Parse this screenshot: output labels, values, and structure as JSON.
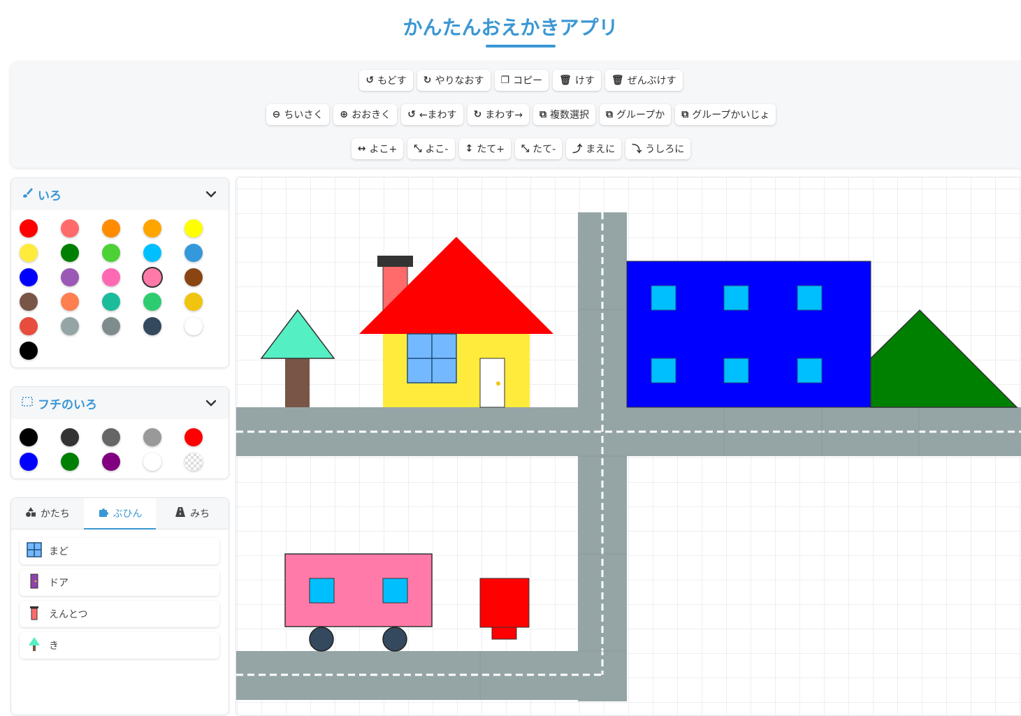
{
  "app": {
    "title": "かんたんおえかきアプリ"
  },
  "toolbar": {
    "row1": [
      {
        "label": "もどす",
        "icon": "undo-icon"
      },
      {
        "label": "やりなおす",
        "icon": "redo-icon"
      },
      {
        "label": "コピー",
        "icon": "copy-icon"
      },
      {
        "label": "けす",
        "icon": "trash-icon"
      },
      {
        "label": "ぜんぶけす",
        "icon": "trash-all-icon"
      }
    ],
    "row2": [
      {
        "label": "ちいさく",
        "icon": "zoom-out-icon"
      },
      {
        "label": "おおきく",
        "icon": "zoom-in-icon"
      },
      {
        "label": "←まわす",
        "icon": "rotate-left-icon"
      },
      {
        "label": "まわす→",
        "icon": "rotate-right-icon"
      },
      {
        "label": "複数選択",
        "icon": "multi-select-icon"
      },
      {
        "label": "グループか",
        "icon": "group-icon"
      },
      {
        "label": "グループかいじょ",
        "icon": "ungroup-icon"
      }
    ],
    "row3": [
      {
        "label": "よこ+",
        "icon": "widen-icon"
      },
      {
        "label": "よこ-",
        "icon": "narrow-icon"
      },
      {
        "label": "たて+",
        "icon": "taller-icon"
      },
      {
        "label": "たて-",
        "icon": "shorter-icon"
      },
      {
        "label": "まえに",
        "icon": "bring-forward-icon"
      },
      {
        "label": "うしろに",
        "icon": "send-backward-icon"
      }
    ]
  },
  "fill_panel": {
    "title": "いろ",
    "icon": "brush-icon",
    "selected": "#ff7aa8",
    "colors": [
      "#ff0000",
      "#ff6b6b",
      "#ff8c00",
      "#ffa500",
      "#ffff00",
      "#ffeb3b",
      "#008000",
      "#4cd137",
      "#00bfff",
      "#3498db",
      "#0000ff",
      "#9b59b6",
      "#ff69b4",
      "#ff7aa8",
      "#8b4513",
      "#795548",
      "#ff7f50",
      "#1abc9c",
      "#2ecc71",
      "#f1c40f",
      "#e74c3c",
      "#95a5a6",
      "#7f8c8d",
      "#34495e",
      "#ffffff",
      "#000000"
    ]
  },
  "stroke_panel": {
    "title": "フチのいろ",
    "icon": "border-icon",
    "colors": [
      "#000000",
      "#333333",
      "#666666",
      "#999999",
      "#ff0000",
      "#0000ff",
      "#008000",
      "#800080",
      "#ffffff",
      "transparent"
    ]
  },
  "tabs": [
    {
      "label": "かたち",
      "icon": "shapes-icon",
      "active": false
    },
    {
      "label": "ぶひん",
      "icon": "puzzle-icon",
      "active": true
    },
    {
      "label": "みち",
      "icon": "road-icon",
      "active": false
    }
  ],
  "parts": [
    {
      "label": "まど",
      "icon": "window-icon"
    },
    {
      "label": "ドア",
      "icon": "door-icon"
    },
    {
      "label": "えんとつ",
      "icon": "chimney-icon"
    },
    {
      "label": "き",
      "icon": "tree-icon"
    }
  ],
  "colors": {
    "accent": "#3a97d4",
    "road": "#95a5a6"
  }
}
